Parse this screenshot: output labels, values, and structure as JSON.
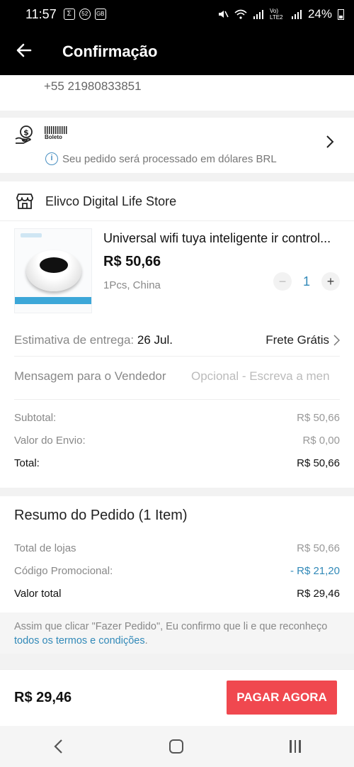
{
  "status": {
    "time": "11:57",
    "icons": [
      "Σ",
      "52",
      "GB"
    ],
    "right_icons": "Vo) LTE2",
    "battery": "24%"
  },
  "appbar": {
    "back_icon": "arrow-left-icon",
    "title": "Confirmação"
  },
  "address": {
    "phone": "+55 21980833851"
  },
  "payment": {
    "method_label": "Boleto",
    "info_text": "Seu pedido será processado em dólares BRL"
  },
  "store": {
    "name": "Elivco Digital Life Store"
  },
  "product": {
    "title": "Universal wifi tuya inteligente ir control...",
    "price": "R$ 50,66",
    "variant": "1Pcs, China",
    "quantity": "1",
    "minus": "−",
    "plus": "+"
  },
  "delivery": {
    "label": "Estimativa de entrega:",
    "date": "26 Jul.",
    "shipping": "Frete Grátis"
  },
  "message": {
    "label": "Mensagem para o Vendedor",
    "placeholder": "Opcional - Escreva a men"
  },
  "subtotals": {
    "subtotal_label": "Subtotal:",
    "subtotal_value": "R$ 50,66",
    "shipping_label": "Valor do Envio:",
    "shipping_value": "R$ 0,00",
    "total_label": "Total:",
    "total_value": "R$ 50,66"
  },
  "summary": {
    "title": "Resumo do Pedido (1 Item)",
    "stores_label": "Total de lojas",
    "stores_value": "R$ 50,66",
    "promo_label": "Código Promocional:",
    "promo_value": "- R$ 21,20",
    "grand_label": "Valor total",
    "grand_value": "R$ 29,46"
  },
  "terms": {
    "text": "Assim que clicar \"Fazer Pedido\", Eu confirmo que li e que reconheço",
    "link": "todos os termos e condições",
    "end": "."
  },
  "footer": {
    "total": "R$ 29,46",
    "button": "PAGAR AGORA"
  },
  "colors": {
    "accent": "#f0484f",
    "link": "#3189b8",
    "appbar": "#000000"
  }
}
